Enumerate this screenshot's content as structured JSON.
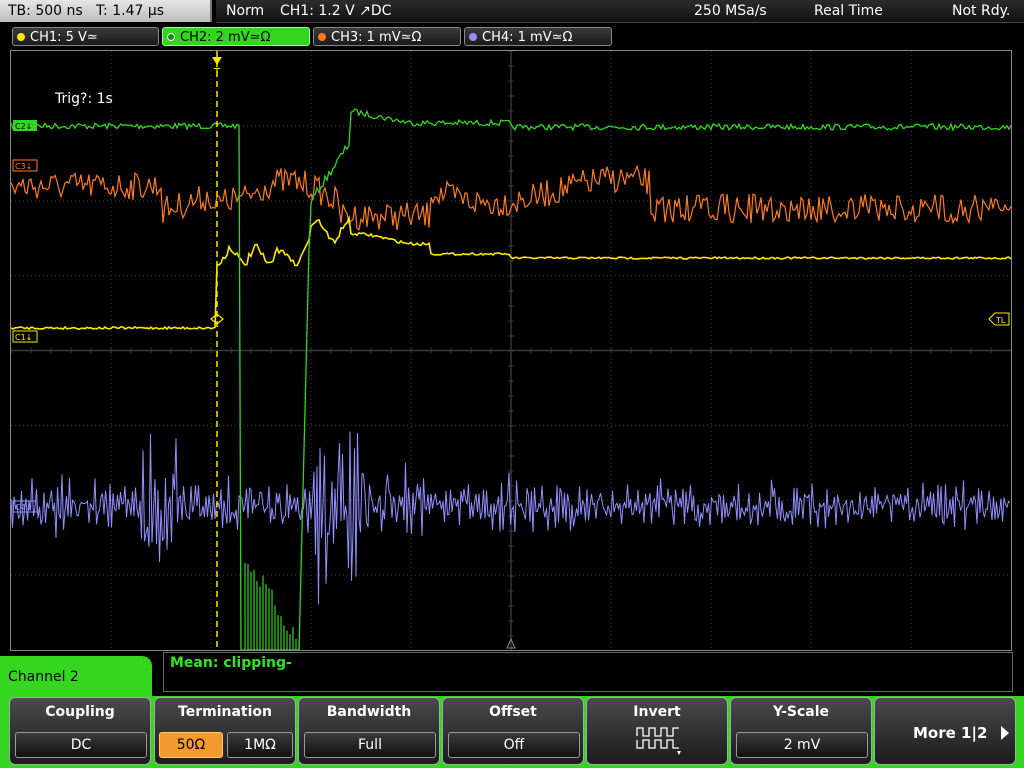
{
  "header": {
    "timebase": "TB: 500 ns",
    "trigger_time": "T: 1.47 µs",
    "mode": "Norm",
    "trigger_source": "CH1: 1.2 V ↗DC",
    "sample_rate": "250 MSa/s",
    "acquisition": "Real Time",
    "status": "Not Rdy."
  },
  "channels": [
    {
      "label": "CH1: 5 V≃",
      "color": "#ffe600",
      "active": false
    },
    {
      "label": "CH2: 2 mV≃Ω",
      "color": "#33d61f",
      "active": true
    },
    {
      "label": "CH3: 1 mV≃Ω",
      "color": "#ff7a1a",
      "active": false
    },
    {
      "label": "CH4: 1 mV≃Ω",
      "color": "#8f8fff",
      "active": false
    }
  ],
  "screen": {
    "trigger_status": "Trig?: 1s",
    "markers": {
      "ch2": "C2↓",
      "ch3": "C3↓",
      "ch1": "C1↓",
      "ch4": "C4↓",
      "trigger_level": "TL",
      "trigger_position": "T"
    }
  },
  "measurement": {
    "text": "Mean: clipping-"
  },
  "menu": {
    "title": "Channel 2",
    "coupling": {
      "label": "Coupling",
      "value": "DC"
    },
    "termination": {
      "label": "Termination",
      "option_a": "50Ω",
      "option_b": "1MΩ",
      "selected": "50Ω"
    },
    "bandwidth": {
      "label": "Bandwidth",
      "value": "Full"
    },
    "offset": {
      "label": "Offset",
      "value": "Off"
    },
    "invert": {
      "label": "Invert",
      "icon": "invert-waveform-icon"
    },
    "yscale": {
      "label": "Y-Scale",
      "value": "2 mV"
    },
    "more": {
      "label": "More 1|2"
    }
  },
  "colors": {
    "ch1": "#ffe600",
    "ch2": "#33d61f",
    "ch3": "#ff7a1a",
    "ch4": "#8f8fff",
    "accent": "#33d61f",
    "selected_option": "#f39a2e"
  }
}
